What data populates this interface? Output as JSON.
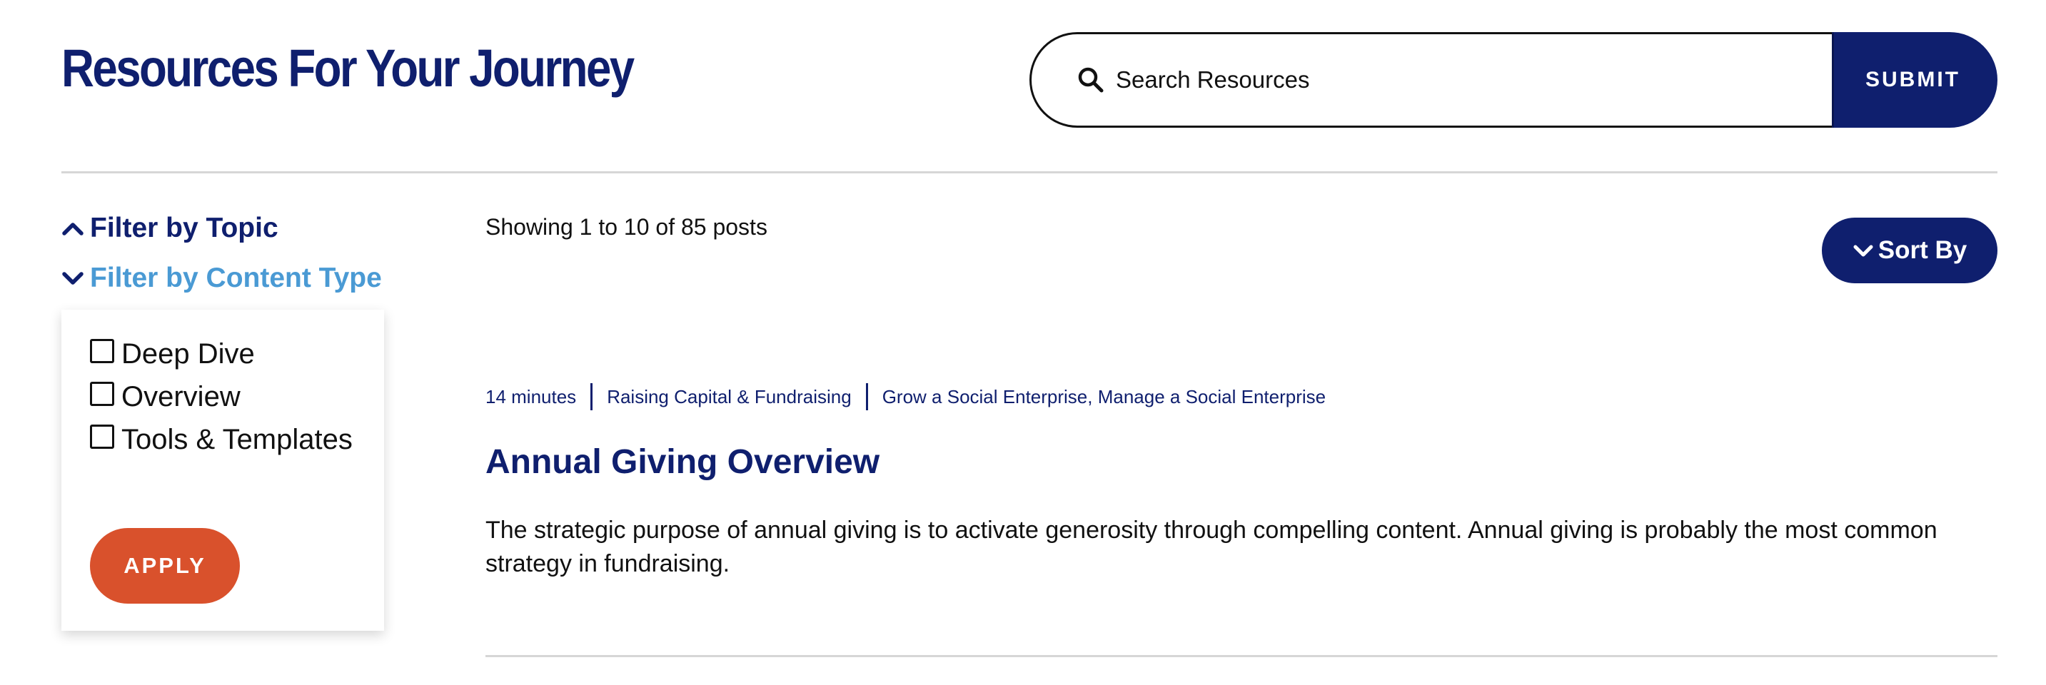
{
  "header": {
    "title": "Resources For Your Journey",
    "search": {
      "placeholder": "Search Resources",
      "icon": "search-icon",
      "submit_label": "SUBMIT"
    }
  },
  "sidebar": {
    "filters": [
      {
        "label": "Filter by Topic",
        "icon": "chevron-up-icon",
        "expanded": false
      },
      {
        "label": "Filter by Content Type",
        "icon": "chevron-down-icon",
        "expanded": true
      }
    ],
    "content_type_options": [
      {
        "label": "Deep Dive",
        "checked": false
      },
      {
        "label": "Overview",
        "checked": false
      },
      {
        "label": "Tools & Templates",
        "checked": false
      }
    ],
    "apply_label": "APPLY"
  },
  "main": {
    "showing": "Showing 1 to 10 of 85 posts",
    "sort_label": "Sort By",
    "posts": [
      {
        "read_time": "14 minutes",
        "category": "Raising Capital & Fundraising",
        "tags": "Grow a Social Enterprise, Manage a Social Enterprise",
        "title": "Annual Giving Overview",
        "excerpt": "The strategic purpose of annual giving is to activate generosity through compelling content. Annual giving is probably the most common strategy in fundraising."
      }
    ]
  },
  "colors": {
    "navy": "#0f1f6e",
    "light_blue": "#4a9ad4",
    "orange": "#d9512c",
    "divider": "#d6d6d6"
  }
}
